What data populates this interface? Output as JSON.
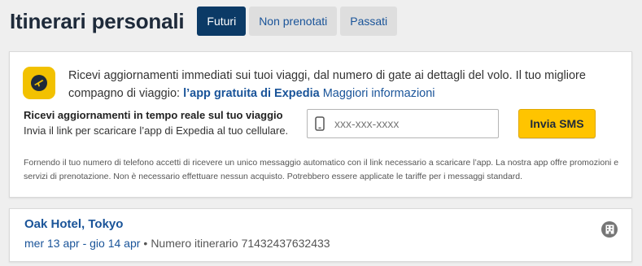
{
  "header": {
    "title": "Itinerari personali",
    "tabs": [
      {
        "label": "Futuri",
        "active": true
      },
      {
        "label": "Non prenotati",
        "active": false
      },
      {
        "label": "Passati",
        "active": false
      }
    ]
  },
  "promo": {
    "icon": "expedia-app-icon",
    "text": "Ricevi aggiornamenti immediati sui tuoi viaggi, dal numero di gate ai dettagli del volo. Il tuo migliore compagno di viaggio: ",
    "app_link": "l’app gratuita di Expedia",
    "more_link": "Maggiori informazioni",
    "sms_title": "Ricevi aggiornamenti in tempo reale sul tuo viaggio",
    "sms_subtitle": "Invia il link per scaricare l’app di Expedia al tuo cellulare.",
    "phone_placeholder": "xxx-xxx-xxxx",
    "phone_icon": "phone-icon",
    "send_button": "Invia SMS",
    "disclaimer": "Fornendo il tuo numero di telefono accetti di ricevere un unico messaggio automatico con il link necessario a scaricare l’app. La nostra app offre promozioni e servizi di prenotazione. Non è necessario effettuare nessun acquisto. Potrebbero essere applicate le tariffe per i messaggi standard."
  },
  "trip": {
    "title": "Oak Hotel, Tokyo",
    "dates": "mer 13 apr - gio 14 apr",
    "separator": "•",
    "itinerary": "Numero itinerario 71432437632433",
    "icon": "hotel-icon"
  },
  "colors": {
    "accent": "#1a5499",
    "active_tab": "#0b3a66",
    "button": "#ffc400",
    "app_icon": "#f2c100"
  }
}
